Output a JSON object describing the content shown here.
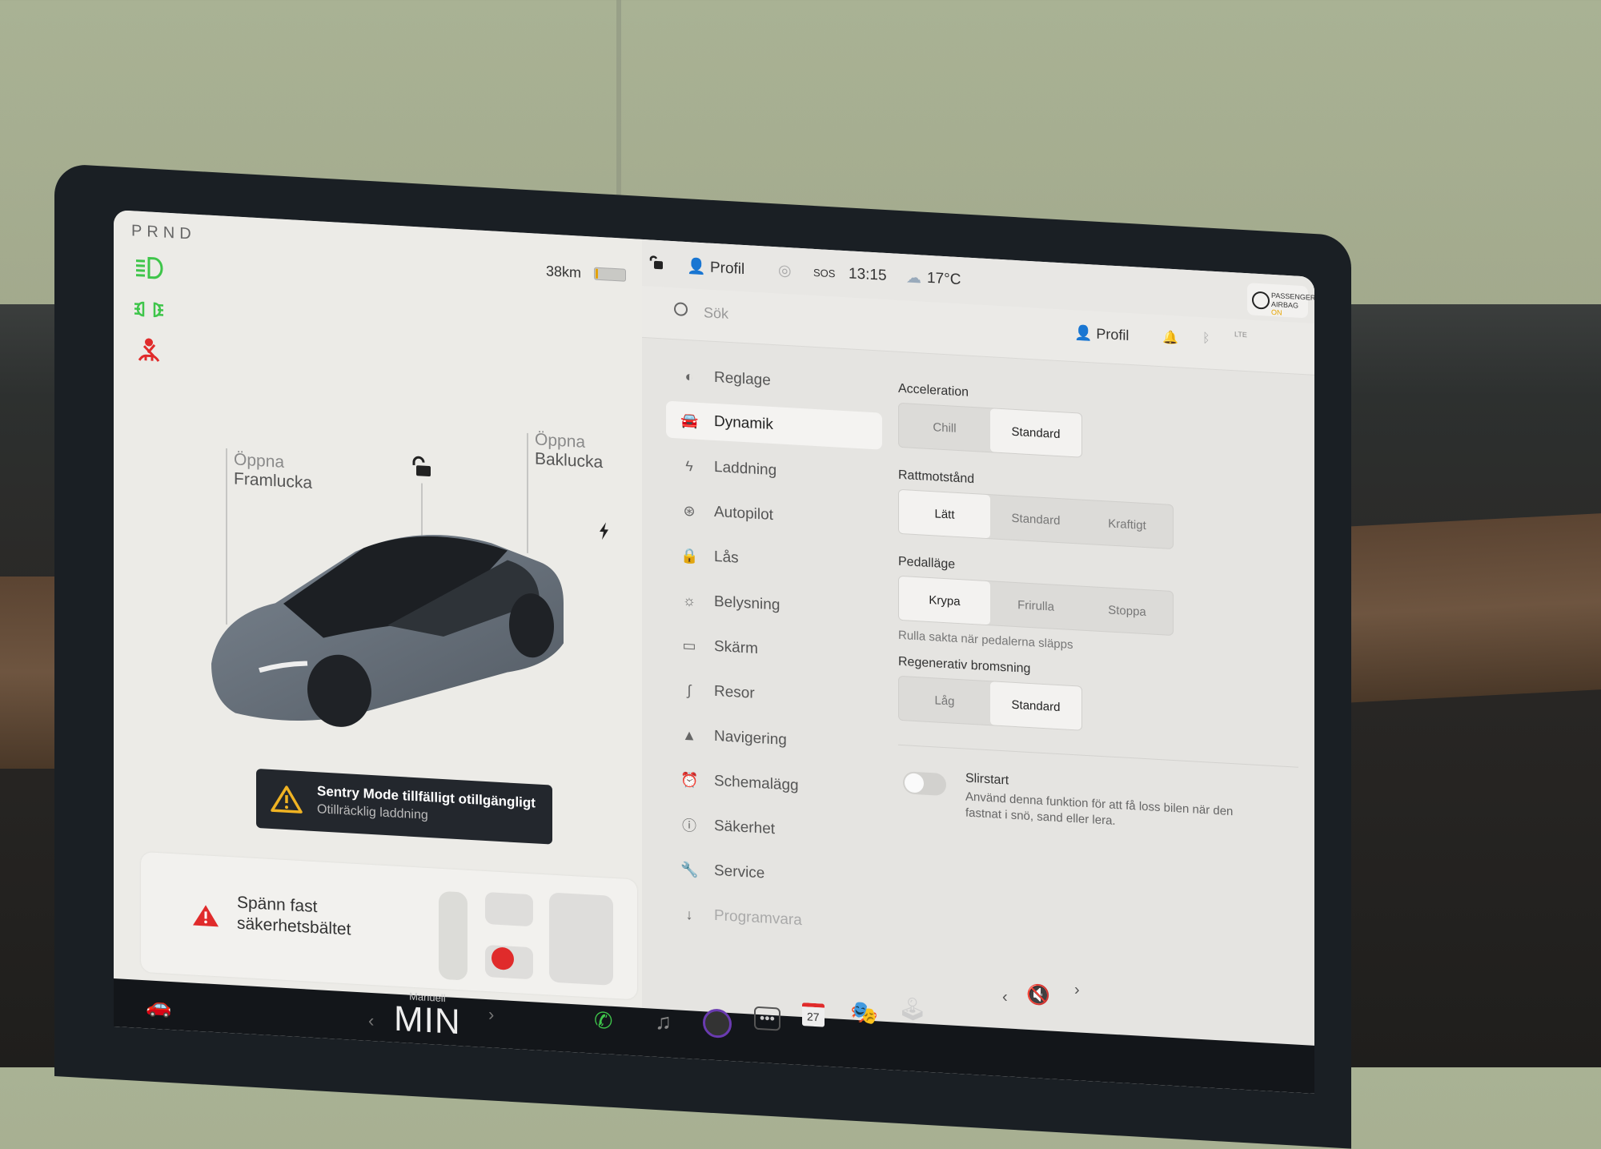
{
  "status": {
    "gear": "PRND",
    "range": "38km",
    "battery_level_pct": 8,
    "profile": "Profil",
    "sos": "SOS",
    "time": "13:15",
    "temperature": "17°C",
    "airbag_line1": "PASSENGER",
    "airbag_line2": "AIRBAG",
    "airbag_state": "ON"
  },
  "telltales": [
    "headlight-icon",
    "parking-lights-icon",
    "seatbelt-warning-icon"
  ],
  "colors": {
    "telltale_green": "#3ec54a",
    "warning_red": "#e02b2b",
    "warning_amber": "#f0b323",
    "dock_bg": "#13161a"
  },
  "car_view": {
    "frunk_line1": "Öppna",
    "frunk_line2": "Framlucka",
    "trunk_line1": "Öppna",
    "trunk_line2": "Baklucka"
  },
  "sentry": {
    "title": "Sentry Mode tillfälligt otillgängligt",
    "subtitle": "Otillräcklig laddning"
  },
  "seatbelt_alert": {
    "line1": "Spänn fast",
    "line2": "säkerhetsbältet"
  },
  "search": {
    "placeholder": "Sök"
  },
  "header_profile": "Profil",
  "header_network": "LTE",
  "nav": [
    {
      "label": "Reglage",
      "icon": "toggle-icon"
    },
    {
      "label": "Dynamik",
      "icon": "car-icon",
      "active": true
    },
    {
      "label": "Laddning",
      "icon": "bolt-icon"
    },
    {
      "label": "Autopilot",
      "icon": "steering-wheel-icon"
    },
    {
      "label": "Lås",
      "icon": "lock-icon"
    },
    {
      "label": "Belysning",
      "icon": "sun-icon"
    },
    {
      "label": "Skärm",
      "icon": "display-icon"
    },
    {
      "label": "Resor",
      "icon": "trips-icon"
    },
    {
      "label": "Navigering",
      "icon": "navigation-icon"
    },
    {
      "label": "Schemalägg",
      "icon": "alarm-clock-icon"
    },
    {
      "label": "Säkerhet",
      "icon": "alert-circle-icon"
    },
    {
      "label": "Service",
      "icon": "wrench-icon"
    },
    {
      "label": "Programvara",
      "icon": "download-icon"
    }
  ],
  "settings": {
    "acceleration": {
      "label": "Acceleration",
      "options": [
        "Chill",
        "Standard"
      ],
      "selected": "Standard"
    },
    "steering": {
      "label": "Rattmotstånd",
      "options": [
        "Lätt",
        "Standard",
        "Kraftigt"
      ],
      "selected": "Lätt"
    },
    "pedal": {
      "label": "Pedalläge",
      "options": [
        "Krypa",
        "Frirulla",
        "Stoppa"
      ],
      "selected": "Krypa",
      "hint": "Rulla sakta när pedalerna släpps"
    },
    "regen": {
      "label": "Regenerativ bromsning",
      "options": [
        "Låg",
        "Standard"
      ],
      "selected": "Standard"
    },
    "slip_start": {
      "label": "Slirstart",
      "description": "Använd denna funktion för att få loss bilen när den fastnat i snö, sand eller lera.",
      "enabled": false
    }
  },
  "dock": {
    "climate_mode": "Manuell",
    "climate_value": "MIN",
    "calendar_day": "27",
    "apps": [
      "phone-icon",
      "music-icon",
      "camera-icon",
      "more-icon",
      "calendar-icon",
      "toybox-icon",
      "arcade-icon"
    ],
    "volume": "muted"
  }
}
